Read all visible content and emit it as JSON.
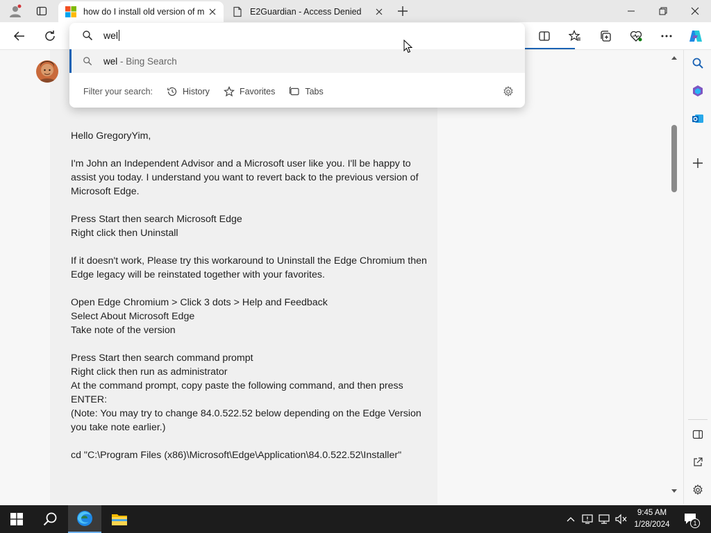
{
  "browser": {
    "tabs": [
      {
        "title": "how do I install old version of m",
        "active": true,
        "favicon": "microsoft-logo"
      },
      {
        "title": "E2Guardian - Access Denied",
        "active": false,
        "favicon": "page-icon"
      }
    ]
  },
  "address_dropdown": {
    "query": "wel",
    "suggestion": {
      "term": "wel",
      "suffix": " - Bing Search"
    },
    "filter_label": "Filter your search:",
    "filters": [
      "History",
      "Favorites",
      "Tabs"
    ]
  },
  "post": {
    "paragraphs": [
      "Hello GregoryYim,",
      "I'm John an Independent Advisor and a Microsoft user like you. I'll be happy to assist you today. I understand you want to revert back to the previous version of Microsoft Edge.",
      "Press Start then search Microsoft Edge\nRight click then Uninstall",
      "If it doesn't work, Please try this workaround to Uninstall the Edge Chromium then Edge legacy will be reinstated together with your favorites.",
      "Open Edge Chromium > Click 3 dots > Help and Feedback\nSelect About Microsoft Edge\nTake note of the version",
      "Press Start then search command prompt\nRight click then run as administrator\nAt the command prompt, copy paste the following command, and then press ENTER:\n(Note: You may try to change 84.0.522.52 below depending on the Edge Version you take note earlier.)",
      "cd \"C:\\Program Files (x86)\\Microsoft\\Edge\\Application\\84.0.522.52\\Installer\""
    ]
  },
  "taskbar": {
    "time": "9:45 AM",
    "date": "1/28/2024",
    "notification_count": "1"
  },
  "colors": {
    "accent": "#1a62b4",
    "taskbar": "#1c1c1c"
  }
}
